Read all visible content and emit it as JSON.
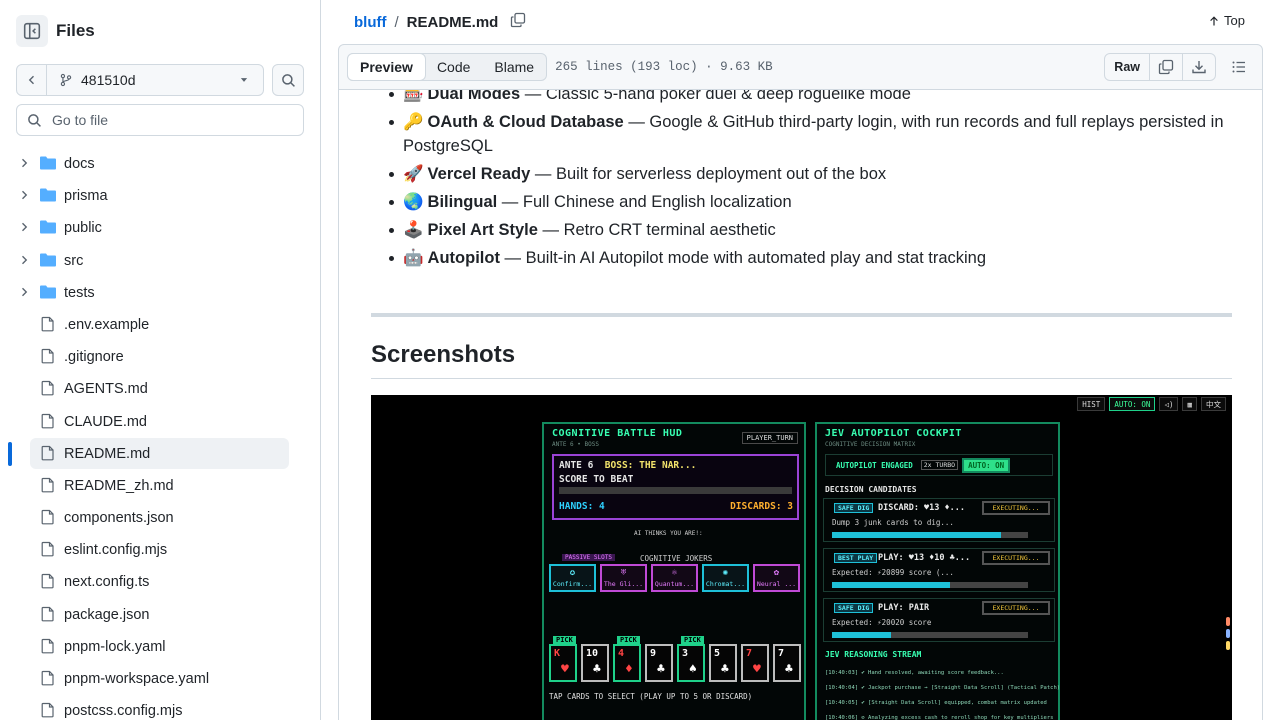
{
  "sidebar": {
    "title": "Files",
    "branch": "481510d",
    "goto_placeholder": "Go to file",
    "items": [
      {
        "label": "docs",
        "type": "folder"
      },
      {
        "label": "prisma",
        "type": "folder"
      },
      {
        "label": "public",
        "type": "folder"
      },
      {
        "label": "src",
        "type": "folder"
      },
      {
        "label": "tests",
        "type": "folder"
      },
      {
        "label": ".env.example",
        "type": "file"
      },
      {
        "label": ".gitignore",
        "type": "file"
      },
      {
        "label": "AGENTS.md",
        "type": "file"
      },
      {
        "label": "CLAUDE.md",
        "type": "file"
      },
      {
        "label": "README.md",
        "type": "file",
        "selected": true
      },
      {
        "label": "README_zh.md",
        "type": "file"
      },
      {
        "label": "components.json",
        "type": "file"
      },
      {
        "label": "eslint.config.mjs",
        "type": "file"
      },
      {
        "label": "next.config.ts",
        "type": "file"
      },
      {
        "label": "package.json",
        "type": "file"
      },
      {
        "label": "pnpm-lock.yaml",
        "type": "file"
      },
      {
        "label": "pnpm-workspace.yaml",
        "type": "file"
      },
      {
        "label": "postcss.config.mjs",
        "type": "file"
      }
    ]
  },
  "header": {
    "repo": "bluff",
    "separator": "/",
    "file": "README.md",
    "top_label": "Top"
  },
  "filebar": {
    "tabs": [
      "Preview",
      "Code",
      "Blame"
    ],
    "active_tab": "Preview",
    "meta": "265 lines (193 loc) · 9.63 KB",
    "raw_label": "Raw"
  },
  "readme": {
    "features": [
      {
        "emoji": "🎰",
        "title": "Dual Modes",
        "text": " — Classic 5-hand poker duel & deep roguelike mode"
      },
      {
        "emoji": "🔑",
        "title": "OAuth & Cloud Database",
        "text": " — Google & GitHub third-party login, with run records and full replays persisted in PostgreSQL"
      },
      {
        "emoji": "🚀",
        "title": "Vercel Ready",
        "text": " — Built for serverless deployment out of the box"
      },
      {
        "emoji": "🌏",
        "title": "Bilingual",
        "text": " — Full Chinese and English localization"
      },
      {
        "emoji": "🕹️",
        "title": "Pixel Art Style",
        "text": " — Retro CRT terminal aesthetic"
      },
      {
        "emoji": "🤖",
        "title": "Autopilot",
        "text": " — Built-in AI Autopilot mode with automated play and stat tracking"
      }
    ],
    "section_heading": "Screenshots"
  },
  "game": {
    "top_chips": [
      "HIST",
      "AUTO: ON",
      "中文"
    ],
    "hud": {
      "title": "COGNITIVE BATTLE HUD",
      "subtitle": "ANTE 6 • BOSS",
      "tag": "PLAYER_TURN",
      "ante": "ANTE 6",
      "boss": "BOSS: THE NAR...",
      "score_label": "SCORE TO BEAT",
      "hands": "HANDS: 4",
      "discards": "DISCARDS: 3",
      "ai_thinks": "AI THINKS YOU ARE!:",
      "passive_label": "PASSIVE SLOTS",
      "jokers_label": "COGNITIVE JOKERS",
      "jokers": [
        "Confirm...",
        "The Gli...",
        "Quantum...",
        "Chromat...",
        "Neural ..."
      ],
      "pick_label": "PICK",
      "cards": [
        {
          "rank": "K",
          "suit": "♥",
          "red": true,
          "picked": true
        },
        {
          "rank": "10",
          "suit": "♣",
          "red": false,
          "picked": false
        },
        {
          "rank": "4",
          "suit": "♦",
          "red": true,
          "picked": true
        },
        {
          "rank": "9",
          "suit": "♣",
          "red": false,
          "picked": false
        },
        {
          "rank": "3",
          "suit": "♠",
          "red": false,
          "picked": true
        },
        {
          "rank": "5",
          "suit": "♣",
          "red": false,
          "picked": false
        },
        {
          "rank": "7",
          "suit": "♥",
          "red": true,
          "picked": false
        },
        {
          "rank": "7",
          "suit": "♣",
          "red": false,
          "picked": false
        }
      ],
      "tap_note": "TAP CARDS TO SELECT (PLAY UP TO 5 OR DISCARD)"
    },
    "cockpit": {
      "title": "JEV AUTOPILOT COCKPIT",
      "subtitle": "COGNITIVE DECISION MATRIX",
      "engaged": "AUTOPILOT ENGAGED",
      "turbo": "2x TURBO",
      "auto": "AUTO: ON",
      "candidates_label": "DECISION CANDIDATES",
      "executing": "EXECUTING...",
      "candidates": [
        {
          "badge": "SAFE DIG",
          "action": "DISCARD: ♥13 ♦...",
          "detail": "Dump 3 junk cards to dig...",
          "fill": 0.86
        },
        {
          "badge": "BEST PLAY",
          "action": "PLAY: ♥13 ♦10 ♣...",
          "detail": "Expected: ⚡20899 score (...",
          "fill": 0.6
        },
        {
          "badge": "SAFE DIG",
          "action": "PLAY: PAIR",
          "detail": "Expected: ⚡20020 score",
          "fill": 0.3
        }
      ],
      "stream_title": "JEV REASONING STREAM",
      "stream": [
        "[10:40:03] ✔ Hand resolved, awaiting score feedback...",
        "[10:40:04] ✔ Jackpot purchase → [Straight Data Scroll] (Tactical Patch)",
        "[10:40:05] ✔ [Straight Data Scroll] equipped, combat matrix updated",
        "[10:40:06] ⊘ Analyzing excess cash to reroll shop for key multipliers"
      ]
    }
  }
}
